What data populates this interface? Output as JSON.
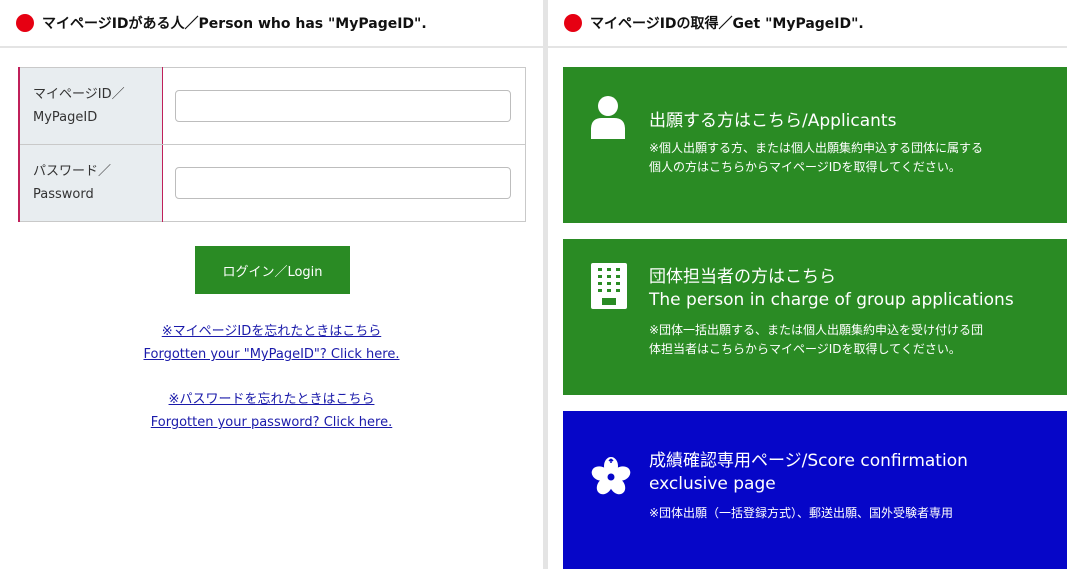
{
  "left_panel": {
    "title": "マイページIDがある人／Person who has \"MyPageID\".",
    "fields": [
      {
        "label_jp": "マイページID／",
        "label_en": "MyPageID",
        "value": "",
        "placeholder": ""
      },
      {
        "label_jp": "パスワード／",
        "label_en": "Password",
        "value": "",
        "placeholder": ""
      }
    ],
    "login_button": "ログイン／Login",
    "links": [
      {
        "jp": "※マイページIDを忘れたときはこちら",
        "en": "Forgotten your \"MyPageID\"? Click here."
      },
      {
        "jp": "※パスワードを忘れたときはこちら",
        "en": "Forgotten your password? Click here."
      }
    ]
  },
  "right_panel": {
    "title": "マイページIDの取得／Get \"MyPageID\".",
    "cards": [
      {
        "icon": "person-icon",
        "color": "#2a8b24",
        "title_lines": [
          "出願する方はこちら/Applicants"
        ],
        "desc_lines": [
          "※個人出願する方、または個人出願集約申込する団体に属する",
          "個人の方はこちらからマイページIDを取得してください。"
        ]
      },
      {
        "icon": "building-icon",
        "color": "#2a8b24",
        "title_lines": [
          "団体担当者の方はこちら",
          "The person in charge of group applications"
        ],
        "desc_lines": [
          "※団体一括出願する、または個人出願集約申込を受け付ける団",
          "体担当者はこちらからマイページIDを取得してください。"
        ]
      },
      {
        "icon": "cherry-blossom-icon",
        "color": "#0606c8",
        "title_lines": [
          "成績確認専用ページ/Score confirmation",
          "exclusive page"
        ],
        "desc_lines": [
          "※団体出願（一括登録方式）、郵送出願、国外受験者専用"
        ]
      }
    ]
  }
}
